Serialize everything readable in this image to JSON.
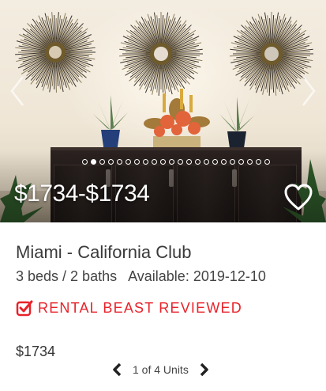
{
  "listing": {
    "price_range": "$1734-$1734",
    "title": "Miami - California Club",
    "beds_baths": "3 beds / 2 baths",
    "available": "Available: 2019-12-10",
    "badge_label": "RENTAL BEAST REVIEWED",
    "unit_price": "$1734"
  },
  "carousel": {
    "photo_count": 22,
    "active_index": 1
  },
  "pager": {
    "label": "1 of 4 Units"
  },
  "colors": {
    "accent_red": "#e8222a",
    "text_dark": "#333333",
    "overlay_text": "#ffffff"
  },
  "icons": {
    "prev_photo": "chevron-left-icon",
    "next_photo": "chevron-right-icon",
    "favorite": "heart-outline-icon",
    "badge": "checkbox-checked-icon",
    "prev_unit": "chevron-left-icon",
    "next_unit": "chevron-right-icon"
  }
}
